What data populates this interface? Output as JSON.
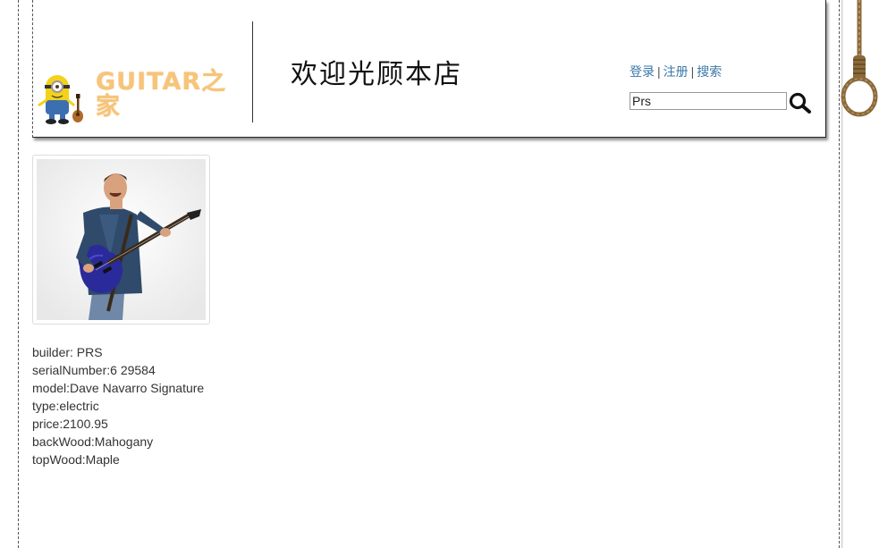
{
  "header": {
    "logo_text": "GUITAR之家",
    "welcome": "欢迎光顾本店",
    "links": {
      "login": "登录",
      "separator": "|",
      "register": "注册",
      "search": "搜索"
    },
    "search_value": "Prs"
  },
  "product": {
    "details": [
      "builder: PRS",
      "serialNumber:6 29584",
      "model:Dave Navarro Signature",
      "type:electric",
      "price:2100.95",
      "backWood:Mahogany",
      "topWood:Maple"
    ]
  },
  "colors": {
    "link": "#3a78a8",
    "logo": "#f6c57a",
    "guitar": "#2a2a9a"
  },
  "icons": {
    "search": "magnifier-icon",
    "logo": "minion-icon",
    "decoration": "noose-rope-icon"
  }
}
